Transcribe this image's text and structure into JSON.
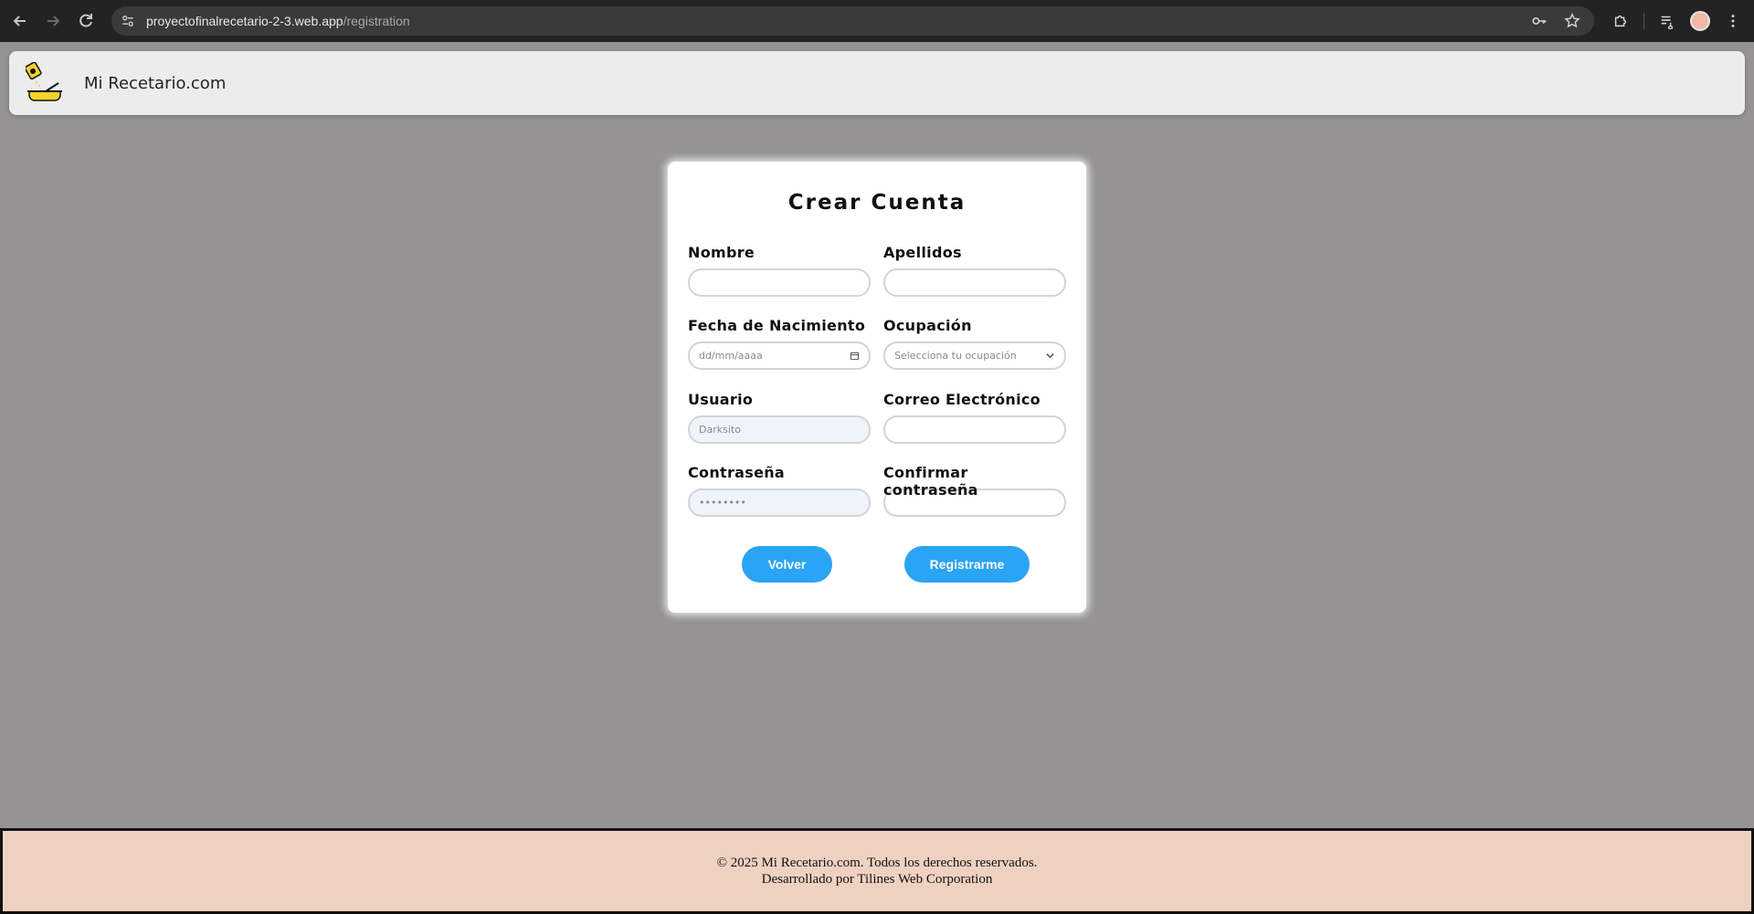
{
  "browser": {
    "url_domain": "proyectofinalrecetario-2-3.web.app",
    "url_path": "/registration"
  },
  "header": {
    "site_title": "Mi Recetario.com",
    "logo_icon": "cooking-pot-logo-icon"
  },
  "form": {
    "title": "Crear Cuenta",
    "fields": {
      "nombre": {
        "label": "Nombre",
        "value": ""
      },
      "apellidos": {
        "label": "Apellidos",
        "value": ""
      },
      "fecha": {
        "label": "Fecha de Nacimiento",
        "placeholder": "dd/mm/aaaa"
      },
      "ocupacion": {
        "label": "Ocupación",
        "selected": "Selecciona tu ocupación"
      },
      "usuario": {
        "label": "Usuario",
        "value": "Darksito"
      },
      "correo": {
        "label": "Correo Electrónico",
        "value": ""
      },
      "contrasena": {
        "label": "Contraseña",
        "value": "••••••••"
      },
      "confirmar": {
        "label": "Confirmar contraseña",
        "value": ""
      }
    },
    "buttons": {
      "back": "Volver",
      "register": "Registrarme"
    },
    "accent_color": "#2aa4f4"
  },
  "footer": {
    "line1": "© 2025 Mi Recetario.com. Todos los derechos reservados.",
    "line2": "Desarrollado por Tilines Web Corporation"
  }
}
